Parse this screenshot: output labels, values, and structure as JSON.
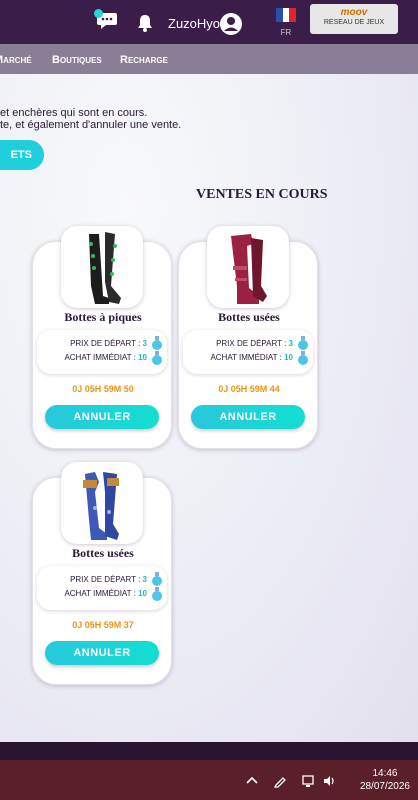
{
  "header": {
    "username": "ZuzoHyo",
    "language": "FR",
    "partner_name": "moov",
    "partner_subtitle": "RESEAU DE JEUX"
  },
  "nav": {
    "items": [
      {
        "label": "Marché"
      },
      {
        "label": "Boutiques"
      },
      {
        "label": "Recharge"
      }
    ]
  },
  "intro": {
    "line1": "et enchères qui sont en cours.",
    "line2": "te, et également d'annuler une vente.",
    "button_label": "ETS"
  },
  "section_title": "VENTES EN COURS",
  "cards": [
    {
      "title": "Bottes à piques",
      "start_label": "PRIX DE DÉPART :",
      "start_value": "3",
      "buy_label": "ACHAT IMMÉDIAT :",
      "buy_value": "10",
      "timer": "0J 05H 59M 50",
      "button": "ANNULER",
      "icon": "spiked-boots"
    },
    {
      "title": "Bottes usées",
      "start_label": "PRIX DE DÉPART :",
      "start_value": "3",
      "buy_label": "ACHAT IMMÉDIAT :",
      "buy_value": "10",
      "timer": "0J 05H 59M 44",
      "button": "ANNULER",
      "icon": "worn-boots-pink"
    },
    {
      "title": "Bottes usées",
      "start_label": "PRIX DE DÉPART :",
      "start_value": "3",
      "buy_label": "ACHAT IMMÉDIAT :",
      "buy_value": "10",
      "timer": "0J 05H 59M 37",
      "button": "ANNULER",
      "icon": "worn-boots-blue"
    }
  ],
  "taskbar": {
    "time": "14:46",
    "date": "28/07/2026"
  },
  "colors": {
    "header_bg": "#3b1d4a",
    "nav_bg": "#8a7d96",
    "accent": "#1fd0dc",
    "timer": "#e8961a",
    "taskbar_bg": "#5b1f2a"
  }
}
